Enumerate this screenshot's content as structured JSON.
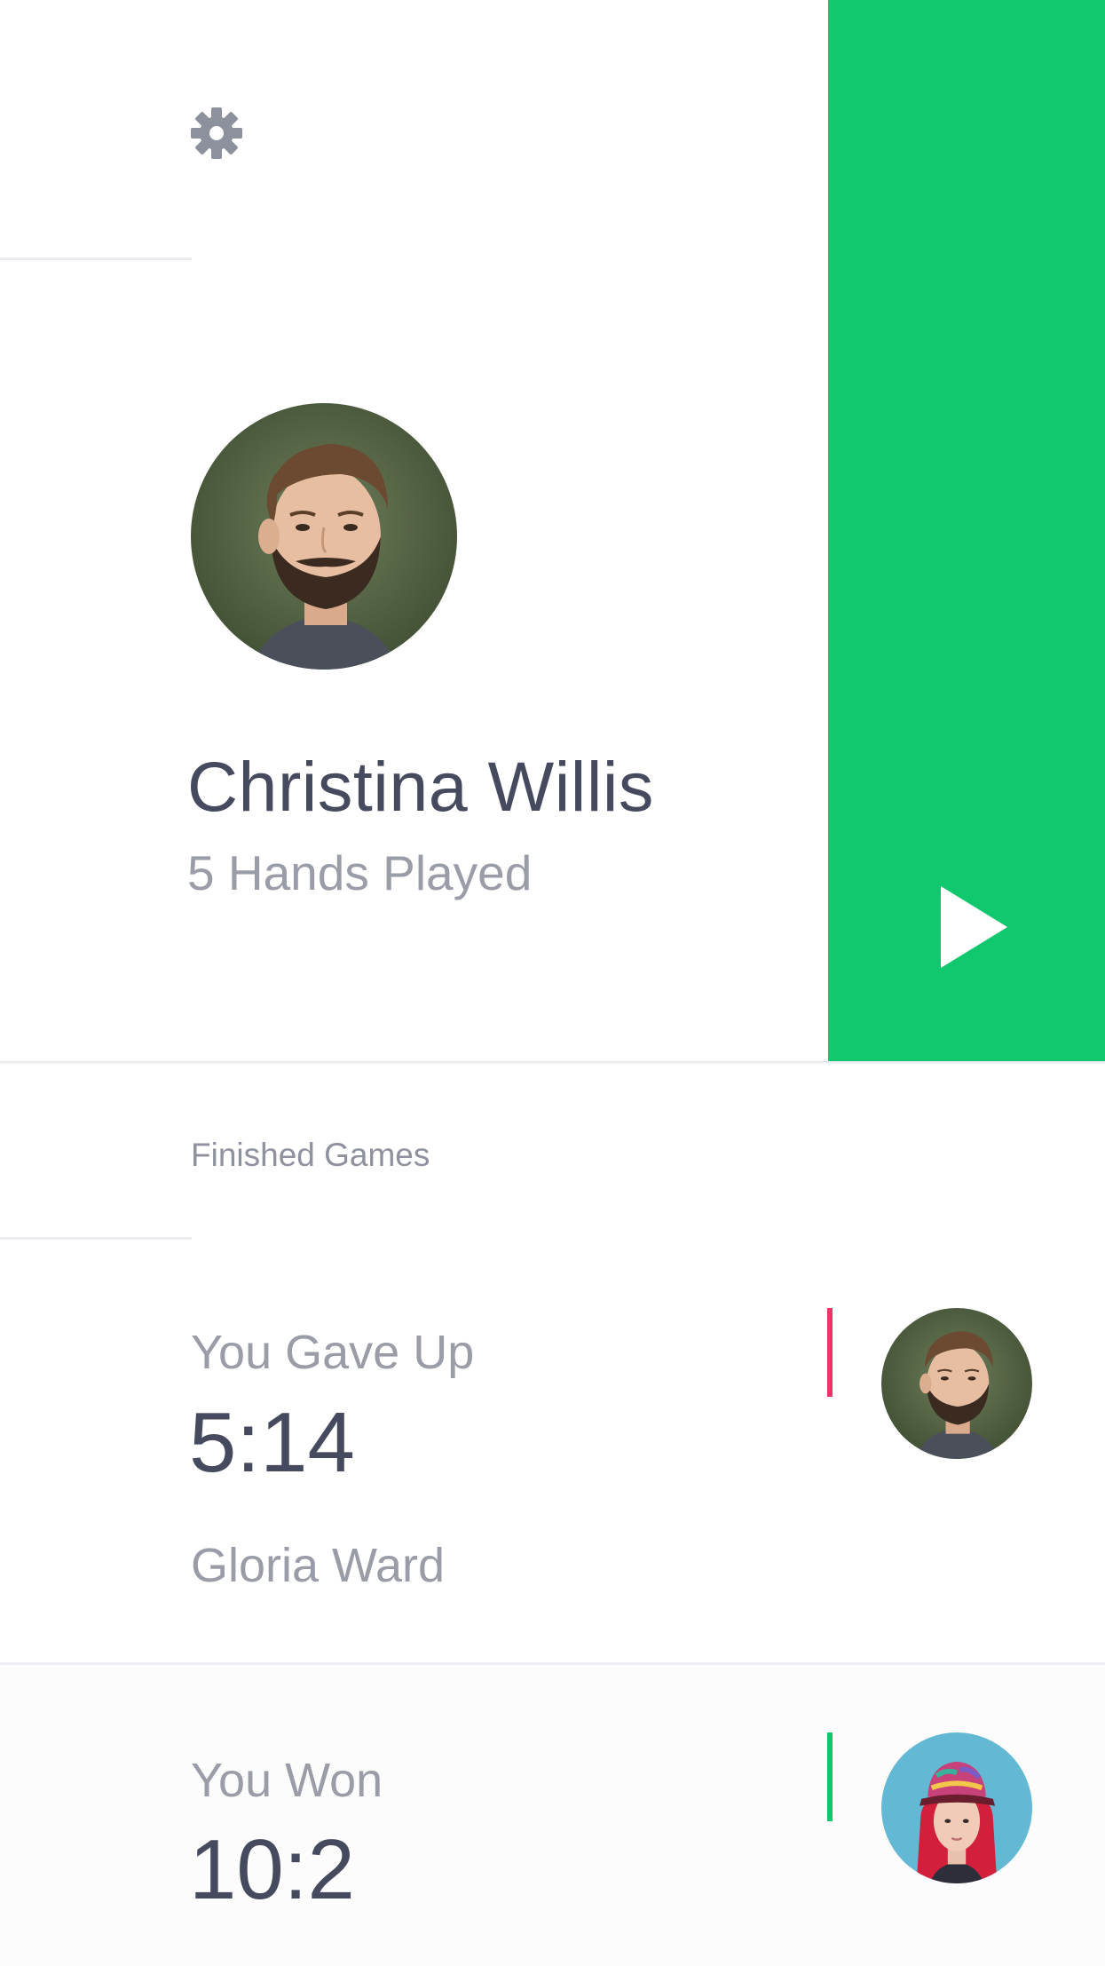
{
  "header": {
    "settings_icon": "gear-icon"
  },
  "profile": {
    "name": "Christina Willis",
    "stats": "5 Hands Played",
    "avatar": "man-with-beard-photo",
    "play_icon": "play-icon"
  },
  "finished_games": {
    "label": "Finished Games",
    "games": [
      {
        "result": "You Gave Up",
        "score": "5:14",
        "opponent": "Gloria Ward",
        "status_color": "#f0346a",
        "avatar": "man-with-beard-photo"
      },
      {
        "result": "You Won",
        "score": "10:2",
        "status_color": "#11c86f",
        "avatar": "woman-red-hair-cap-photo"
      }
    ]
  },
  "colors": {
    "accent_green": "#11c86f",
    "accent_red": "#f0346a",
    "text_dark": "#454a5f",
    "text_muted": "#9a9ca8",
    "icon_gray": "#8c919d"
  }
}
